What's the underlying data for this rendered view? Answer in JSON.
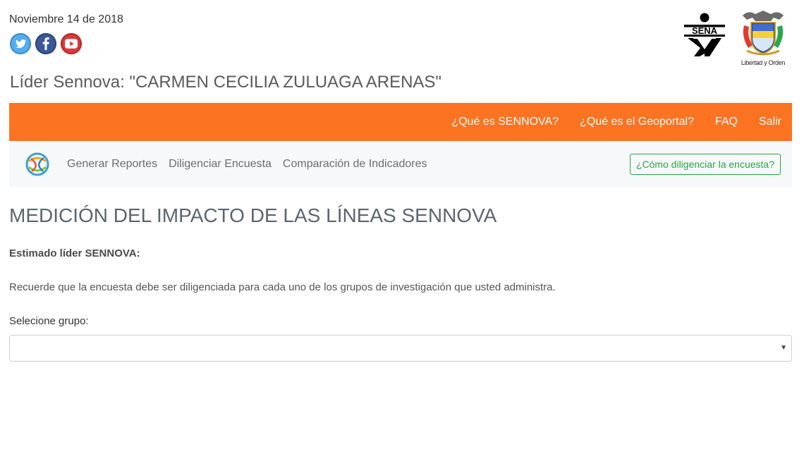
{
  "header": {
    "date": "Noviembre 14 de 2018",
    "social": [
      {
        "name": "twitter",
        "icon": "twitter-icon",
        "color": "#55acee"
      },
      {
        "name": "facebook",
        "icon": "facebook-icon",
        "color": "#3b5998"
      },
      {
        "name": "youtube",
        "icon": "youtube-icon",
        "color": "#d93a3a"
      }
    ],
    "sena_logo_text": "SENA",
    "coat_caption": "Libertad y Orden",
    "leader": "Líder Sennova: \"CARMEN CECILIA ZULUAGA ARENAS\""
  },
  "top_nav": {
    "background": "#fc7322",
    "items": [
      "¿Qué es SENNOVA?",
      "¿Qué es el Geoportal?",
      "FAQ",
      "Salir"
    ]
  },
  "sub_nav": {
    "items": [
      "Generar Reportes",
      "Diligenciar Encuesta",
      "Comparación de Indicadores"
    ],
    "help_button": "¿Cómo diligenciar la encuesta?",
    "help_color": "#28a745"
  },
  "main": {
    "title": "MEDICIÓN DEL IMPACTO DE LAS LÍNEAS SENNOVA",
    "greeting": "Estimado líder SENNOVA:",
    "notice": "Recuerde que la encuesta debe ser diligenciada para cada uno de los grupos de investigación que usted administra.",
    "select_label": "Selecione grupo:",
    "select_value": ""
  }
}
